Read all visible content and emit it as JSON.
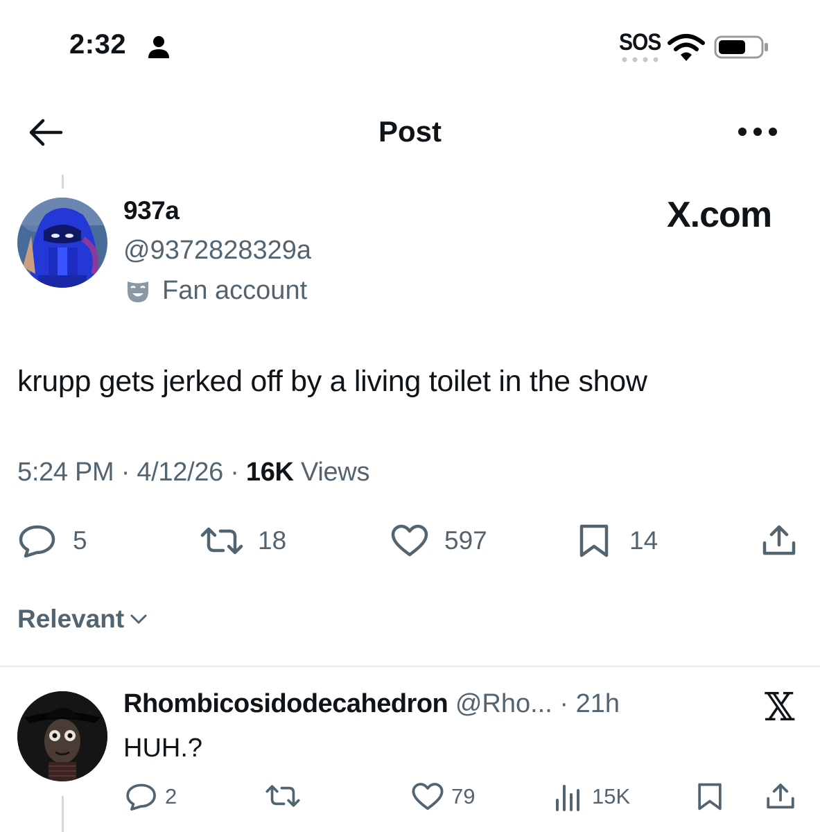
{
  "status_bar": {
    "time": "2:32",
    "person_icon": "person-icon",
    "sos": "SOS",
    "wifi_icon": "wifi-icon",
    "battery_icon": "battery-icon"
  },
  "nav": {
    "title": "Post",
    "back_icon": "arrow-left-icon",
    "more_icon": "ellipsis-icon"
  },
  "post": {
    "display_name": "937a",
    "handle": "@9372828329a",
    "label": "Fan account",
    "watermark": "X.com",
    "text": "krupp gets jerked off by a living toilet in the show",
    "time": "5:24 PM",
    "separator": "·",
    "date": "4/12/26",
    "views_count": "16K",
    "views_label": "Views",
    "actions": {
      "replies": "5",
      "reposts": "18",
      "likes": "597",
      "bookmarks": "14"
    }
  },
  "sort": {
    "label": "Relevant"
  },
  "reply": {
    "display_name": "Rhombicosidodecahedron",
    "handle": "@Rho...",
    "separator": "·",
    "age": "21h",
    "x_logo": "𝕏",
    "text": "HUH.?",
    "actions": {
      "replies": "2",
      "likes": "79",
      "views": "15K"
    }
  },
  "colors": {
    "text_primary": "#0f1419",
    "text_secondary": "#536471",
    "avatar1_bg": "#2438d6",
    "avatar2_bg": "#1a1a1a"
  }
}
